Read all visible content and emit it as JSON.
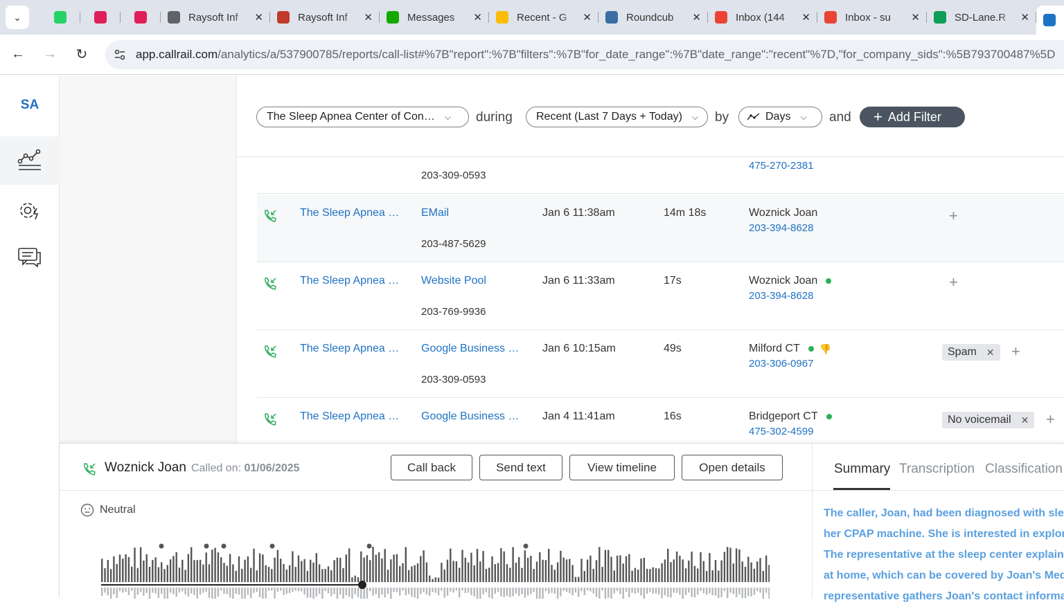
{
  "browser": {
    "tabs": [
      {
        "title": "",
        "favicon": "whatsapp-icon",
        "color": "#25d366",
        "icon_only": true
      },
      {
        "title": "",
        "favicon": "slack-icon",
        "color": "#e01e5a",
        "icon_only": true
      },
      {
        "title": "",
        "favicon": "slack-icon",
        "color": "#e01e5a",
        "icon_only": true
      },
      {
        "title": "Raysoft Inf",
        "favicon": "globe-icon",
        "color": "#5f6368",
        "icon_only": false
      },
      {
        "title": "Raysoft Inf",
        "favicon": "raysoft-icon",
        "color": "#c0392b",
        "icon_only": false
      },
      {
        "title": "Messages",
        "favicon": "upwork-icon",
        "color": "#14a800",
        "icon_only": false
      },
      {
        "title": "Recent - G",
        "favicon": "google-drive-icon",
        "color": "#fbbc04",
        "icon_only": false
      },
      {
        "title": "Roundcub",
        "favicon": "roundcube-icon",
        "color": "#3a6ea5",
        "icon_only": false
      },
      {
        "title": "Inbox (144",
        "favicon": "gmail-icon",
        "color": "#ea4335",
        "icon_only": false
      },
      {
        "title": "Inbox - su",
        "favicon": "gmail-icon",
        "color": "#ea4335",
        "icon_only": false
      },
      {
        "title": "SD-Lane.R",
        "favicon": "google-sheets-icon",
        "color": "#0f9d58",
        "icon_only": false
      }
    ],
    "url_host": "app.callrail.com",
    "url_path": "/analytics/a/537900785/reports/call-list#%7B\"report\":%7B\"filters\":%7B\"for_date_range\":%7B\"date_range\":\"recent\"%7D,\"for_company_sids\":%5B793700487%5D"
  },
  "rail": {
    "logo": "SA"
  },
  "filters": {
    "company": "The Sleep Apnea Center of Con…",
    "during": "during",
    "date_range": "Recent (Last 7 Days + Today)",
    "by": "by",
    "interval": "Days",
    "and": "and",
    "add_filter": "Add Filter"
  },
  "calls": {
    "partial_row": {
      "tracking_number": "203-309-0593",
      "caller_phone": "475-270-2381"
    },
    "rows": [
      {
        "company": "The Sleep Apnea …",
        "source": "EMail",
        "tracking_number": "203-487-5629",
        "date": "Jan 6 11:38am",
        "duration": "14m 18s",
        "caller_name": "Woznick Joan",
        "caller_phone": "203-394-8628",
        "dot": false,
        "thumb": false,
        "tag": ""
      },
      {
        "company": "The Sleep Apnea …",
        "source": "Website Pool",
        "tracking_number": "203-769-9936",
        "date": "Jan 6 11:33am",
        "duration": "17s",
        "caller_name": "Woznick Joan",
        "caller_phone": "203-394-8628",
        "dot": true,
        "thumb": false,
        "tag": ""
      },
      {
        "company": "The Sleep Apnea …",
        "source": "Google Business …",
        "tracking_number": "203-309-0593",
        "date": "Jan 6 10:15am",
        "duration": "49s",
        "caller_name": "Milford CT",
        "caller_phone": "203-306-0967",
        "dot": true,
        "thumb": true,
        "tag": "Spam"
      },
      {
        "company": "The Sleep Apnea …",
        "source": "Google Business …",
        "tracking_number": "",
        "date": "Jan 4 11:41am",
        "duration": "16s",
        "caller_name": "Bridgeport CT",
        "caller_phone": "475-302-4599",
        "dot": true,
        "thumb": false,
        "tag": "No voicemail"
      }
    ]
  },
  "detail": {
    "caller_name": "Woznick Joan",
    "called_on_label": "Called on:",
    "called_on_date": "01/06/2025",
    "buttons": {
      "call_back": "Call back",
      "send_text": "Send text",
      "view_timeline": "View timeline",
      "open_details": "Open details"
    },
    "sentiment": "Neutral",
    "tabs": {
      "summary": "Summary",
      "transcription": "Transcription",
      "classification": "Classification"
    },
    "summary_lines": [
      "The caller, Joan, had been diagnosed with slee",
      "her CPAP machine. She is interested in explorin",
      "The representative at the sleep center explains",
      "at home, which can be covered by Joan's Medic",
      "representative gathers Joan's contact informat"
    ]
  },
  "colors": {
    "link": "#1f72c4",
    "status_dot": "#2eae5a",
    "add_filter_bg": "#4a5561",
    "summary_text": "#5aa0df"
  }
}
